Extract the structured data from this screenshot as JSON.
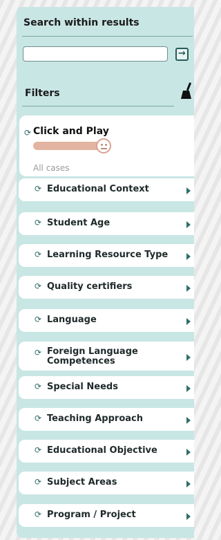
{
  "search": {
    "title": "Search within results",
    "input_value": "",
    "go_icon": "arrow-right-box-icon"
  },
  "filters": {
    "title": "Filters",
    "clear_icon": "broom-icon"
  },
  "click_and_play": {
    "title": "Click and Play",
    "subtitle": "All cases",
    "slider_level": 0.9
  },
  "filter_items": [
    {
      "label": "Educational Context"
    },
    {
      "label": "Student Age"
    },
    {
      "label": "Learning Resource Type"
    },
    {
      "label": "Quality certifiers"
    },
    {
      "label": "Language"
    },
    {
      "label": "Foreign Language Competences"
    },
    {
      "label": "Special Needs"
    },
    {
      "label": "Teaching Approach"
    },
    {
      "label": "Educational Objective"
    },
    {
      "label": "Subject Areas"
    },
    {
      "label": "Program / Project"
    }
  ],
  "colors": {
    "panel_bg": "#c8e6e4",
    "accent": "#2f6e6a",
    "slider": "#e3b4a2"
  }
}
